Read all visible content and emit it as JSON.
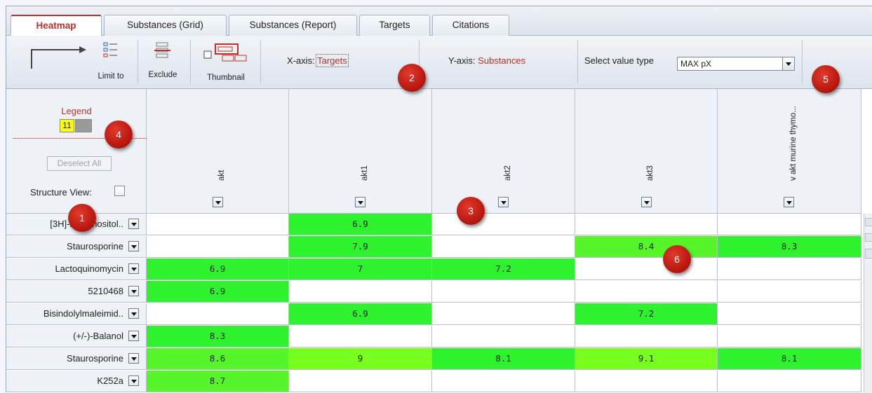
{
  "tabs": [
    {
      "label": "Heatmap",
      "active": true
    },
    {
      "label": "Substances (Grid)",
      "active": false
    },
    {
      "label": "Substances (Report)",
      "active": false
    },
    {
      "label": "Targets",
      "active": false
    },
    {
      "label": "Citations",
      "active": false
    }
  ],
  "toolbar": {
    "limit_to_label": "Limit to",
    "exclude_label": "Exclude",
    "thumbnail_label": "Thumbnail",
    "x_axis_label": "X-axis:",
    "x_axis_value": "Targets",
    "y_axis_label": "Y-axis:",
    "y_axis_value": "Substances",
    "value_type_label": "Select value type",
    "value_type_selected": "MAX pX"
  },
  "legend": {
    "title": "Legend",
    "count": "11",
    "deselect_label": "Deselect All",
    "structure_view_label": "Structure View:"
  },
  "columns": [
    "akt",
    "akt1",
    "akt2",
    "akt3",
    "v akt murine thymo..."
  ],
  "rows": [
    {
      "name": "[3H]-myo-inositol..",
      "values": [
        "",
        "6.9",
        "",
        "",
        ""
      ]
    },
    {
      "name": "Staurosporine",
      "values": [
        "",
        "7.9",
        "",
        "8.4",
        "8.3"
      ]
    },
    {
      "name": "Lactoquinomycin",
      "values": [
        "6.9",
        "7",
        "7.2",
        "",
        ""
      ]
    },
    {
      "name": "5210468",
      "values": [
        "6.9",
        "",
        "",
        "",
        ""
      ]
    },
    {
      "name": "Bisindolylmaleimid..",
      "values": [
        "",
        "6.9",
        "",
        "7.2",
        ""
      ]
    },
    {
      "name": "(+/-)-Balanol",
      "values": [
        "8.3",
        "",
        "",
        "",
        ""
      ]
    },
    {
      "name": "Staurosporine",
      "values": [
        "8.6",
        "9",
        "8.1",
        "9.1",
        "8.1"
      ]
    },
    {
      "name": "K252a",
      "values": [
        "8.7",
        "",
        "",
        "",
        ""
      ]
    }
  ],
  "markers": [
    "1",
    "2",
    "3",
    "4",
    "5",
    "6"
  ],
  "colors": {
    "accent": "#c0302a",
    "heat_green": "#2ff22f",
    "heat_lime": "#78ff1e",
    "legend_yellow": "#ffff00"
  }
}
